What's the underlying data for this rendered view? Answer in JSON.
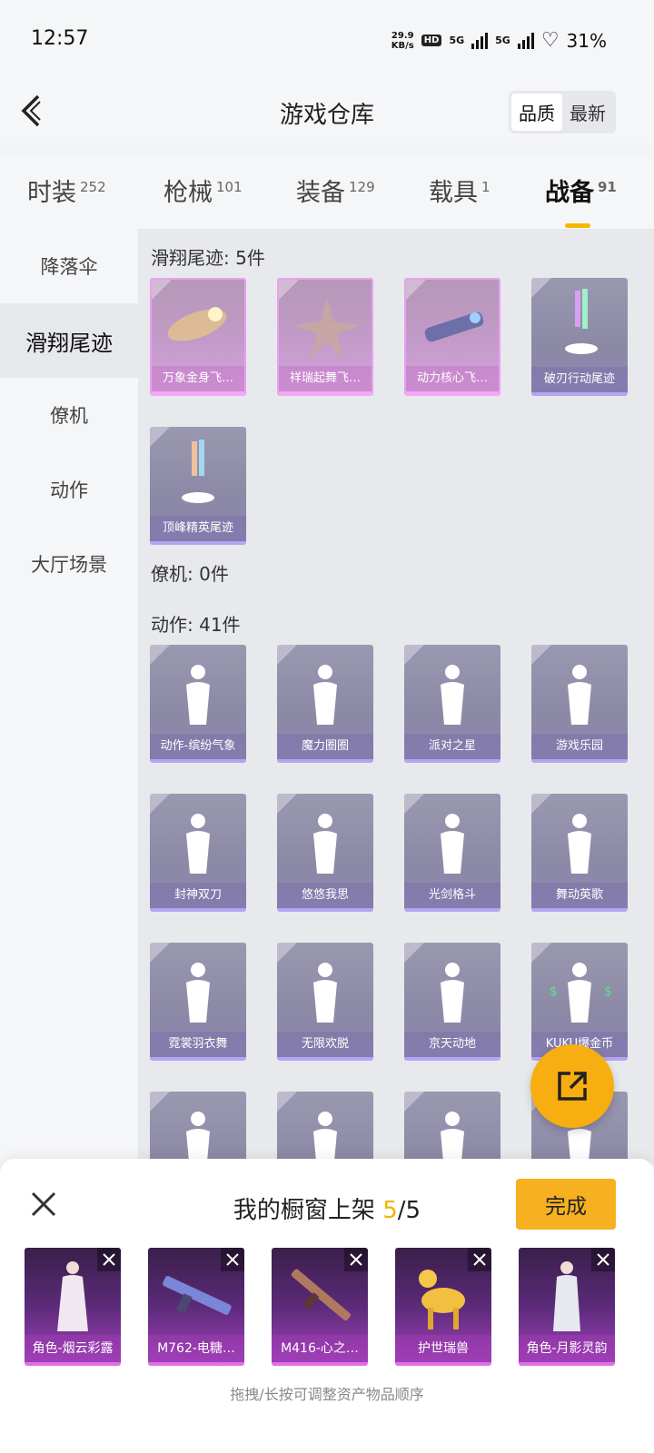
{
  "status": {
    "time": "12:57",
    "speed": "29.9",
    "speed_unit": "KB/s",
    "hd": "HD",
    "net1": "5G",
    "net2": "5G",
    "battery": "31%"
  },
  "header": {
    "title": "游戏仓库",
    "sort": [
      "品质",
      "最新"
    ]
  },
  "tabs": [
    {
      "label": "时装",
      "count": "252"
    },
    {
      "label": "枪械",
      "count": "101"
    },
    {
      "label": "装备",
      "count": "129"
    },
    {
      "label": "载具",
      "count": "1"
    },
    {
      "label": "战备",
      "count": "91"
    }
  ],
  "sidebar": [
    "降落伞",
    "滑翔尾迹",
    "僚机",
    "动作",
    "大厅场景"
  ],
  "sections": {
    "glide": {
      "heading": "滑翔尾迹: 5件",
      "items": [
        "万象金身飞…",
        "祥瑞起舞飞…",
        "动力核心飞…",
        "破刃行动尾迹",
        "顶峰精英尾迹"
      ]
    },
    "wingman": {
      "heading": "僚机: 0件"
    },
    "action": {
      "heading": "动作: 41件",
      "items": [
        "动作-缤纷气象",
        "魔力圈圈",
        "派对之星",
        "游戏乐园",
        "封神双刀",
        "悠悠我思",
        "光剑格斗",
        "舞动英歌",
        "霓裳羽衣舞",
        "无限欢脱",
        "京天动地",
        "KUKU爆金币"
      ]
    }
  },
  "sheet": {
    "title": "我的橱窗上架",
    "current": "5",
    "total": "/5",
    "done": "完成",
    "items": [
      "角色-烟云彩露",
      "M762-电糖…",
      "M416-心之…",
      "护世瑞兽",
      "角色-月影灵韵"
    ],
    "hint": "拖拽/长按可调整资产物品顺序"
  },
  "icons": {
    "back": "back-chevron-icon",
    "fab": "share-export-icon",
    "close": "close-icon"
  },
  "colors": {
    "accent": "#f5b400",
    "purple_rarity": "#b5a4f2",
    "pink_rarity": "#f3a8f5"
  }
}
